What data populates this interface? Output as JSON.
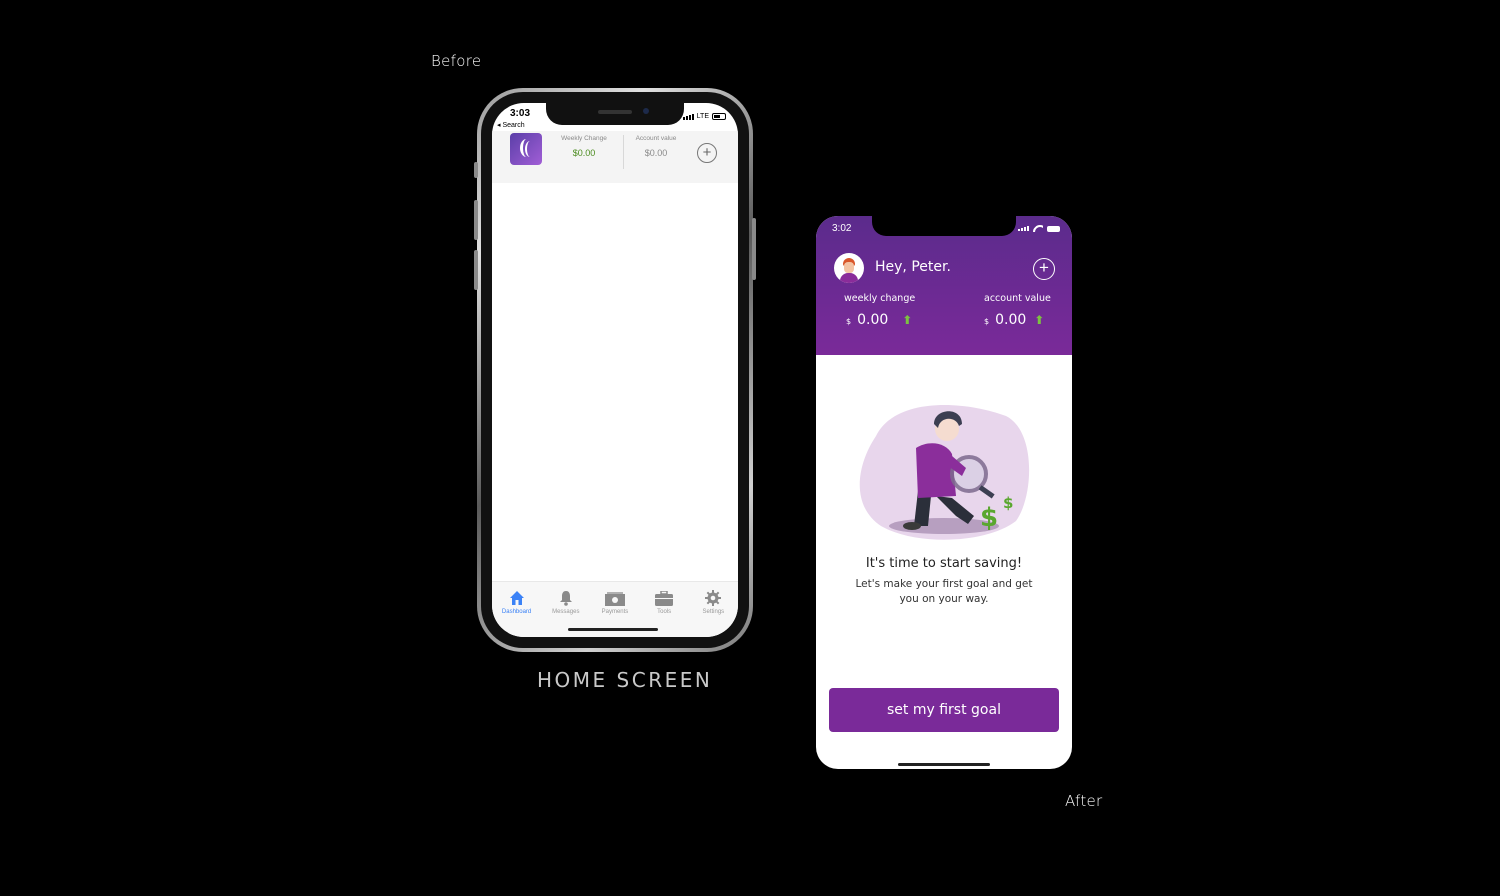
{
  "captions": {
    "before": "Before",
    "after": "After",
    "home_screen": "HOME SCREEN"
  },
  "before_phone": {
    "status_time": "3:03",
    "network": "LTE",
    "back_label": "◂ Search",
    "weekly_change_label": "Weekly Change",
    "weekly_change_value": "$0.00",
    "account_value_label": "Account value",
    "account_value_value": "$0.00",
    "add_icon": "plus-circle",
    "tabs": [
      {
        "label": "Dashboard",
        "icon": "home-icon",
        "active": true
      },
      {
        "label": "Messages",
        "icon": "bell-icon",
        "active": false
      },
      {
        "label": "Payments",
        "icon": "money-icon",
        "active": false
      },
      {
        "label": "Tools",
        "icon": "briefcase-icon",
        "active": false
      },
      {
        "label": "Settings",
        "icon": "gear-icon",
        "active": false
      }
    ],
    "colors": {
      "active_tab": "#3b82f6",
      "weekly_value": "#4a8b1e"
    }
  },
  "after_phone": {
    "status_time": "3:02",
    "greeting": "Hey, Peter.",
    "weekly_change_label": "weekly change",
    "weekly_change_currency": "$",
    "weekly_change_value": "0.00",
    "account_value_label": "account value",
    "account_value_currency": "$",
    "account_value_value": "0.00",
    "arrow": "⬆",
    "headline": "It's time to start saving!",
    "subtext": "Let's make your first goal and get you on your way.",
    "cta_label": "set my first goal",
    "colors": {
      "header": "#7a2a99",
      "cta": "#7a2a99",
      "arrow": "#7cc241"
    }
  }
}
